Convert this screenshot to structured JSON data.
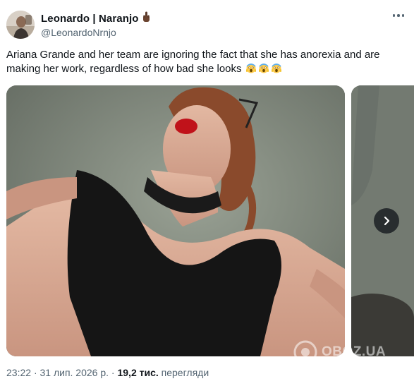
{
  "author": {
    "display_name": "Leonardo | Naranjo",
    "handle": "@LeonardoNrnjo",
    "name_emoji_icon": "middle-finger-emoji"
  },
  "tweet": {
    "text": "Ariana Grande and her team are ignoring the fact that she has anorexia and are making her work, regardless of how bad she looks",
    "emoji_icons": [
      "screaming-face-emoji",
      "screaming-face-emoji",
      "screaming-face-emoji"
    ]
  },
  "media": {
    "main_image_icon": "photo-woman-black-dress",
    "next_button_icon": "chevron-right-icon"
  },
  "meta": {
    "time": "23:22",
    "separator": "·",
    "date": "31 лип. 2026 р.",
    "views_count": "19,2",
    "views_unit": "тис.",
    "views_label": "перегляди"
  },
  "watermark": {
    "text": "OBOZ.UA"
  },
  "colors": {
    "text_primary": "#0f1419",
    "text_secondary": "#536471",
    "background": "#ffffff"
  }
}
